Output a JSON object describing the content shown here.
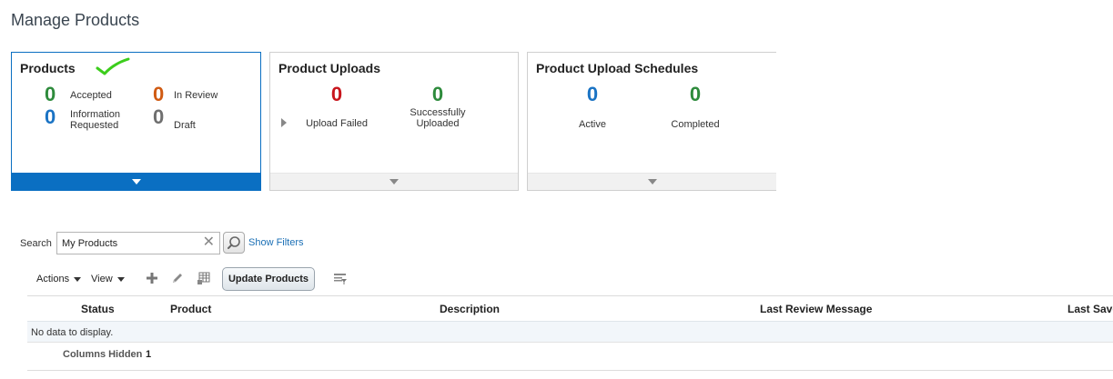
{
  "page": {
    "title": "Manage Products"
  },
  "cards": {
    "products": {
      "title": "Products",
      "metrics": [
        {
          "value": "0",
          "label": "Accepted",
          "color": "#2e8b3c"
        },
        {
          "value": "0",
          "label": "In Review",
          "color": "#d05a12"
        },
        {
          "value": "0",
          "label_line1": "Information",
          "label_line2": "Requested",
          "color": "#1a73c4"
        },
        {
          "value": "0",
          "label": "Draft",
          "color": "#6f6f6f"
        }
      ]
    },
    "uploads": {
      "title": "Product Uploads",
      "metrics": [
        {
          "value": "0",
          "label": "Upload Failed",
          "color": "#c8161d"
        },
        {
          "value": "0",
          "label_line1": "Successfully",
          "label_line2": "Uploaded",
          "color": "#2e8b3c"
        }
      ]
    },
    "schedules": {
      "title": "Product Upload Schedules",
      "metrics": [
        {
          "value": "0",
          "label": "Active",
          "color": "#1a73c4"
        },
        {
          "value": "0",
          "label": "Completed",
          "color": "#2e8b3c"
        }
      ]
    }
  },
  "search": {
    "label": "Search",
    "value": "My Products",
    "show_filters": "Show Filters"
  },
  "toolbar": {
    "actions": "Actions",
    "view": "View",
    "update_products": "Update Products"
  },
  "table": {
    "columns": [
      "Status",
      "Product",
      "Description",
      "Last Review Message",
      "Last Saved"
    ],
    "empty_text": "No data to display.",
    "columns_hidden_label": "Columns Hidden",
    "columns_hidden_count": "1"
  },
  "colors": {
    "selected_accent": "#0a6fc2",
    "link": "#1a6fb5"
  }
}
